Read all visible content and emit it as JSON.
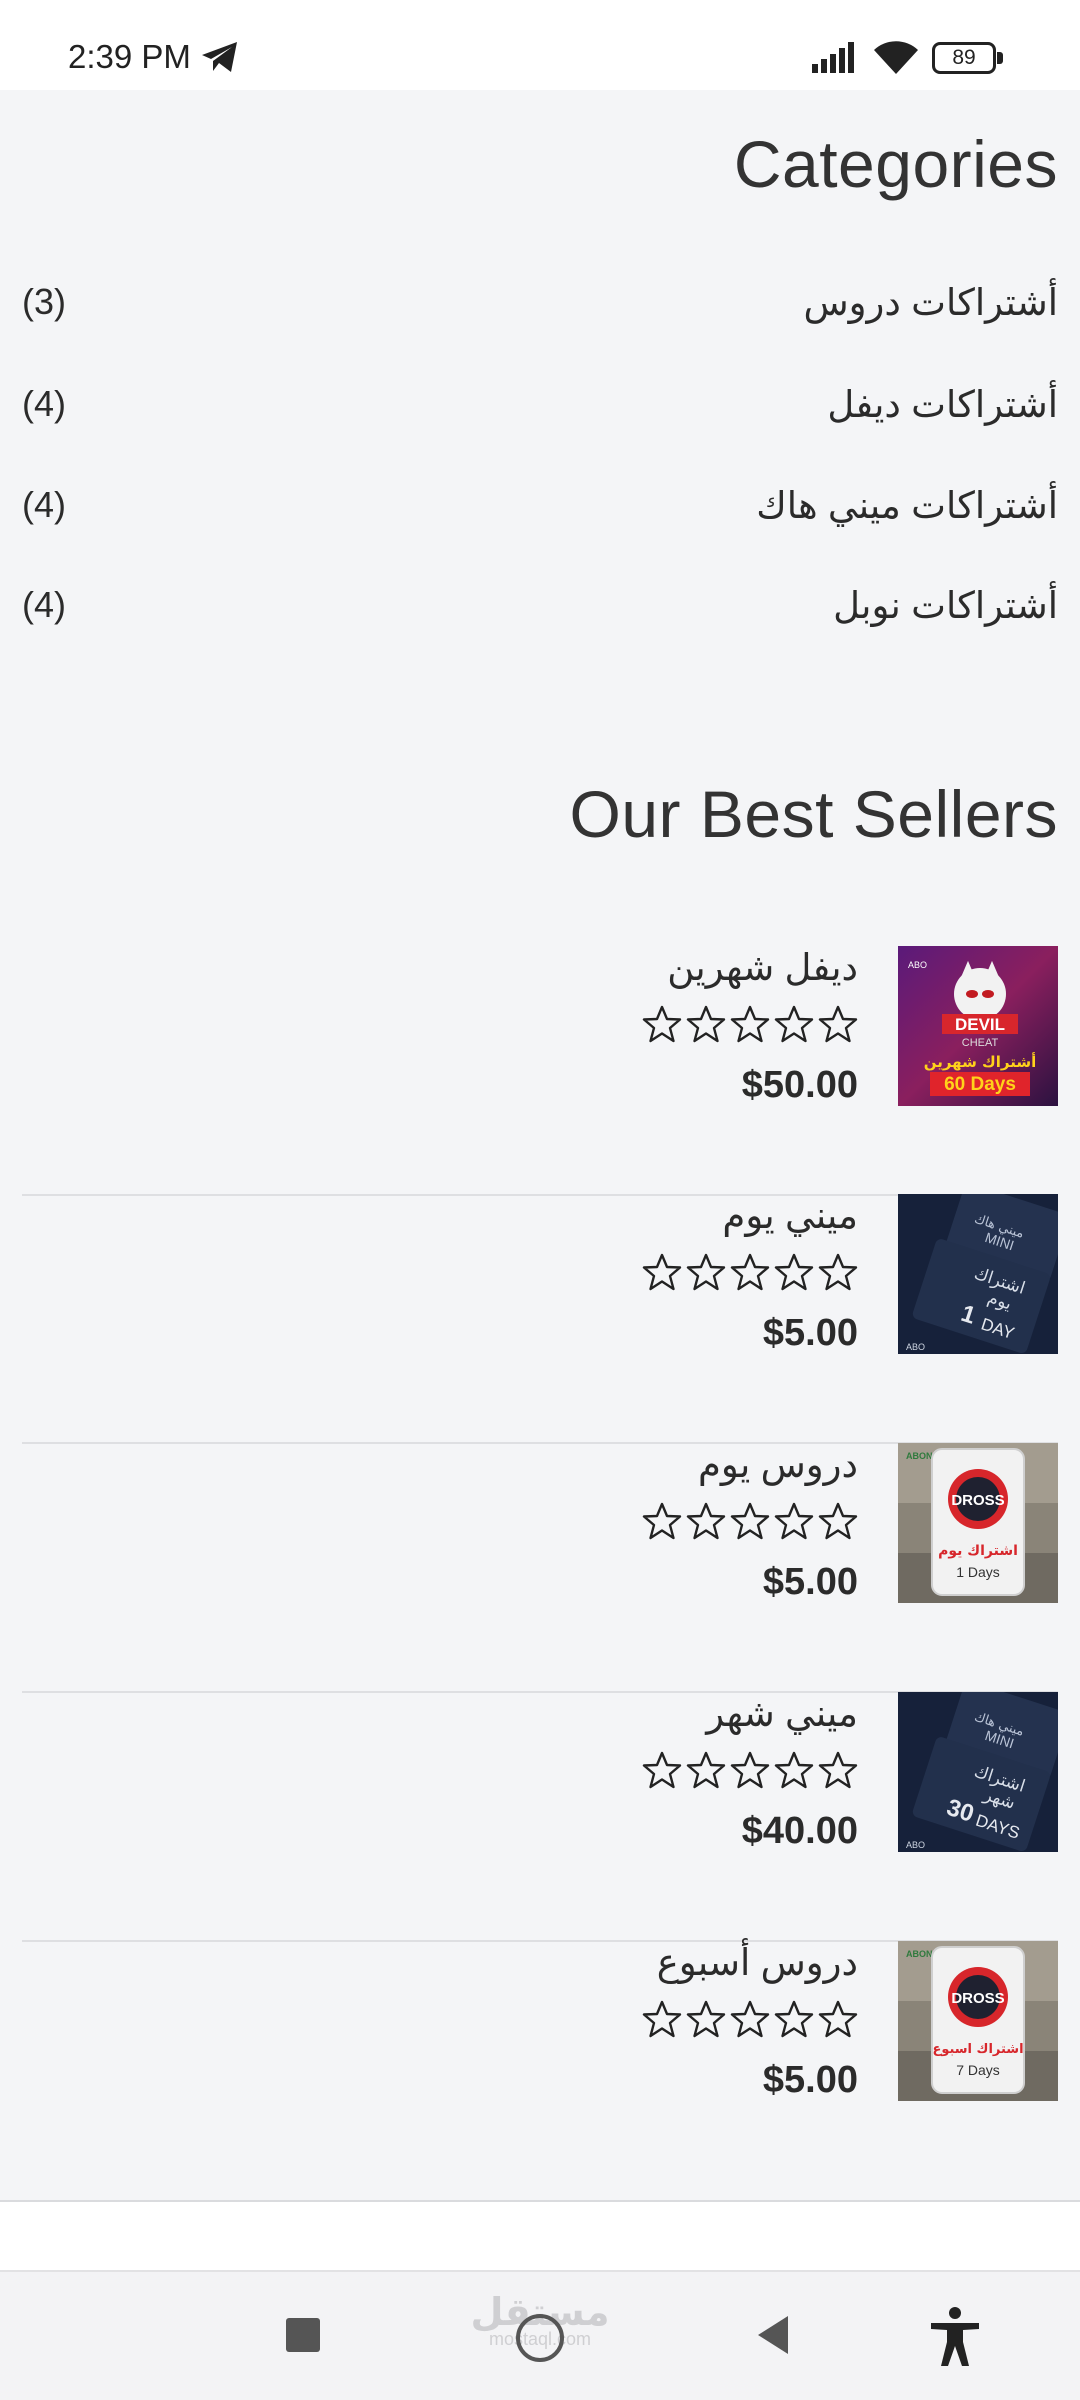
{
  "status_bar": {
    "time": "2:39 PM",
    "battery": "89",
    "icons": [
      "telegram-icon",
      "signal-icon",
      "wifi-icon",
      "battery-icon"
    ]
  },
  "categories": {
    "title": "Categories",
    "items": [
      {
        "name": "أشتراكات دروس",
        "count": "(3)"
      },
      {
        "name": "أشتراكات ديفل",
        "count": "(4)"
      },
      {
        "name": "أشتراكات ميني هاك",
        "count": "(4)"
      },
      {
        "name": "أشتراكات نوبل",
        "count": "(4)"
      }
    ]
  },
  "best_sellers": {
    "title": "Our Best Sellers",
    "items": [
      {
        "name": "ديفل شهرين",
        "price": "$50.00",
        "rating": 0,
        "max_rating": 5,
        "thumb": {
          "kind": "devil",
          "brand": "DEVIL",
          "brand_sub": "CHEAT",
          "caption": "أشتراك شهرين",
          "days": "60 Days",
          "watermark": "ABO"
        }
      },
      {
        "name": "ميني يوم",
        "price": "$5.00",
        "rating": 0,
        "max_rating": 5,
        "thumb": {
          "kind": "mini",
          "top_line": "ميني هاك",
          "top_sub": "MINI",
          "caption": "اشتراك",
          "caption2": "يوم",
          "num": "1",
          "unit": "DAY",
          "watermark": "ABO"
        }
      },
      {
        "name": "دروس يوم",
        "price": "$5.00",
        "rating": 0,
        "max_rating": 5,
        "thumb": {
          "kind": "dross",
          "brand": "DROSS",
          "caption": "اشتراك يوم",
          "days": "1 Days",
          "watermark": "ABONAD"
        }
      },
      {
        "name": "ميني شهر",
        "price": "$40.00",
        "rating": 0,
        "max_rating": 5,
        "thumb": {
          "kind": "mini",
          "top_line": "ميني هاك",
          "top_sub": "MINI",
          "caption": "اشتراك",
          "caption2": "شهر",
          "num": "30",
          "unit": "DAYS",
          "watermark": "ABO"
        }
      },
      {
        "name": "دروس أسبوع",
        "price": "$5.00",
        "rating": 0,
        "max_rating": 5,
        "thumb": {
          "kind": "dross",
          "brand": "DROSS",
          "caption": "اشتراك اسبوع",
          "days": "7 Days",
          "watermark": "ABONAD"
        }
      }
    ]
  },
  "nav_bar": {
    "buttons": [
      "recents-button",
      "home-button",
      "back-button",
      "accessibility-button"
    ],
    "watermark": "مستقل",
    "watermark_sub": "mostaql.com"
  },
  "colors": {
    "background": "#f4f5f7",
    "text": "#2b2b2b",
    "divider": "#dedfe2",
    "devil_red": "#e0242b",
    "devil_yellow": "#ffd21a",
    "mini_navy": "#1e2a44",
    "dross_red": "#d7262b"
  }
}
